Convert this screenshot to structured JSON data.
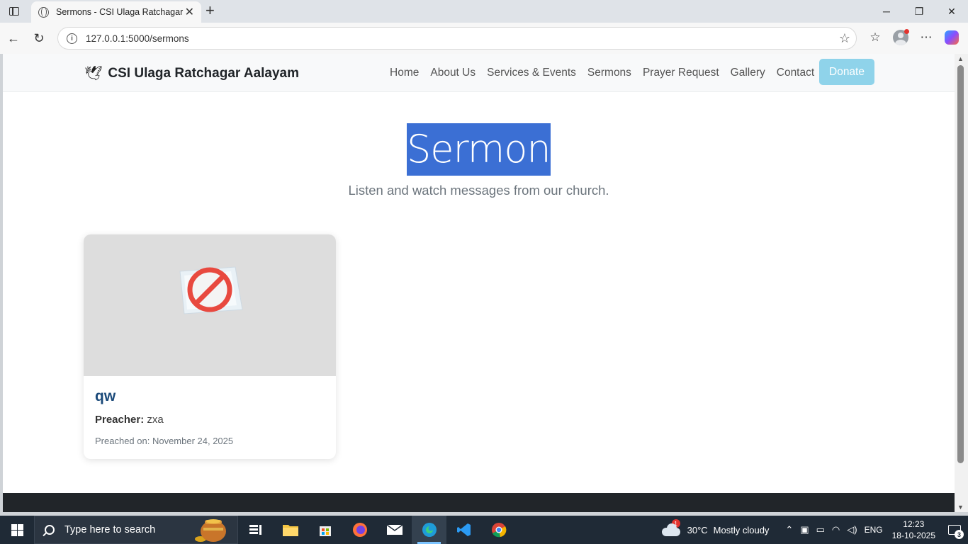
{
  "browser": {
    "tab_title": "Sermons - CSI Ulaga Ratchagar Aalayam",
    "url": "127.0.0.1:5000/sermons",
    "window_controls": {
      "minimize": "─",
      "maximize": "❐",
      "close": "✕"
    }
  },
  "site": {
    "brand": "CSI Ulaga Ratchagar Aalayam",
    "nav": [
      "Home",
      "About Us",
      "Services & Events",
      "Sermons",
      "Prayer Request",
      "Gallery",
      "Contact"
    ],
    "donate_label": "Donate",
    "colors": {
      "donate_bg": "#8fd3ea",
      "title_highlight": "#3b6fd4",
      "card_title": "#1b4a7a",
      "footer": "#212529"
    }
  },
  "page": {
    "title": "Sermons",
    "subtitle": "Listen and watch messages from our church."
  },
  "sermons": [
    {
      "title": "qw",
      "preacher_label": "Preacher:",
      "preacher": "zxa",
      "date_text": "Preached on: November 24, 2025",
      "image": "no-image-icon"
    }
  ],
  "taskbar": {
    "search_placeholder": "Type here to search",
    "weather_badge": "1",
    "temperature": "30°C",
    "weather_text": "Mostly cloudy",
    "language": "ENG",
    "time": "12:23",
    "date": "18-10-2025",
    "notification_count": "3"
  }
}
